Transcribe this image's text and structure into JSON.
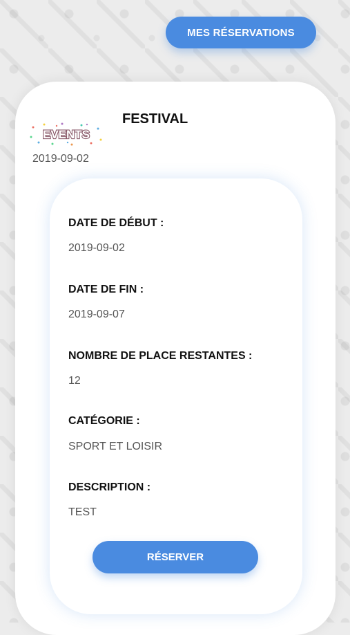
{
  "header": {
    "reservations_button": "MES RÉSERVATIONS"
  },
  "event": {
    "title": "FESTIVAL",
    "logo_text": "EVENTS",
    "date": "2019-09-02"
  },
  "details": {
    "start_label": "DATE DE DÉBUT :",
    "start_value": "2019-09-02",
    "end_label": "DATE DE FIN :",
    "end_value": "2019-09-07",
    "places_label": "NOMBRE DE PLACE RESTANTES :",
    "places_value": "12",
    "category_label": "CATÉGORIE :",
    "category_value": "SPORT ET LOISIR",
    "description_label": "DESCRIPTION :",
    "description_value": "TEST"
  },
  "actions": {
    "reserve_button": "RÉSERVER"
  },
  "colors": {
    "accent": "#4a8be0"
  }
}
